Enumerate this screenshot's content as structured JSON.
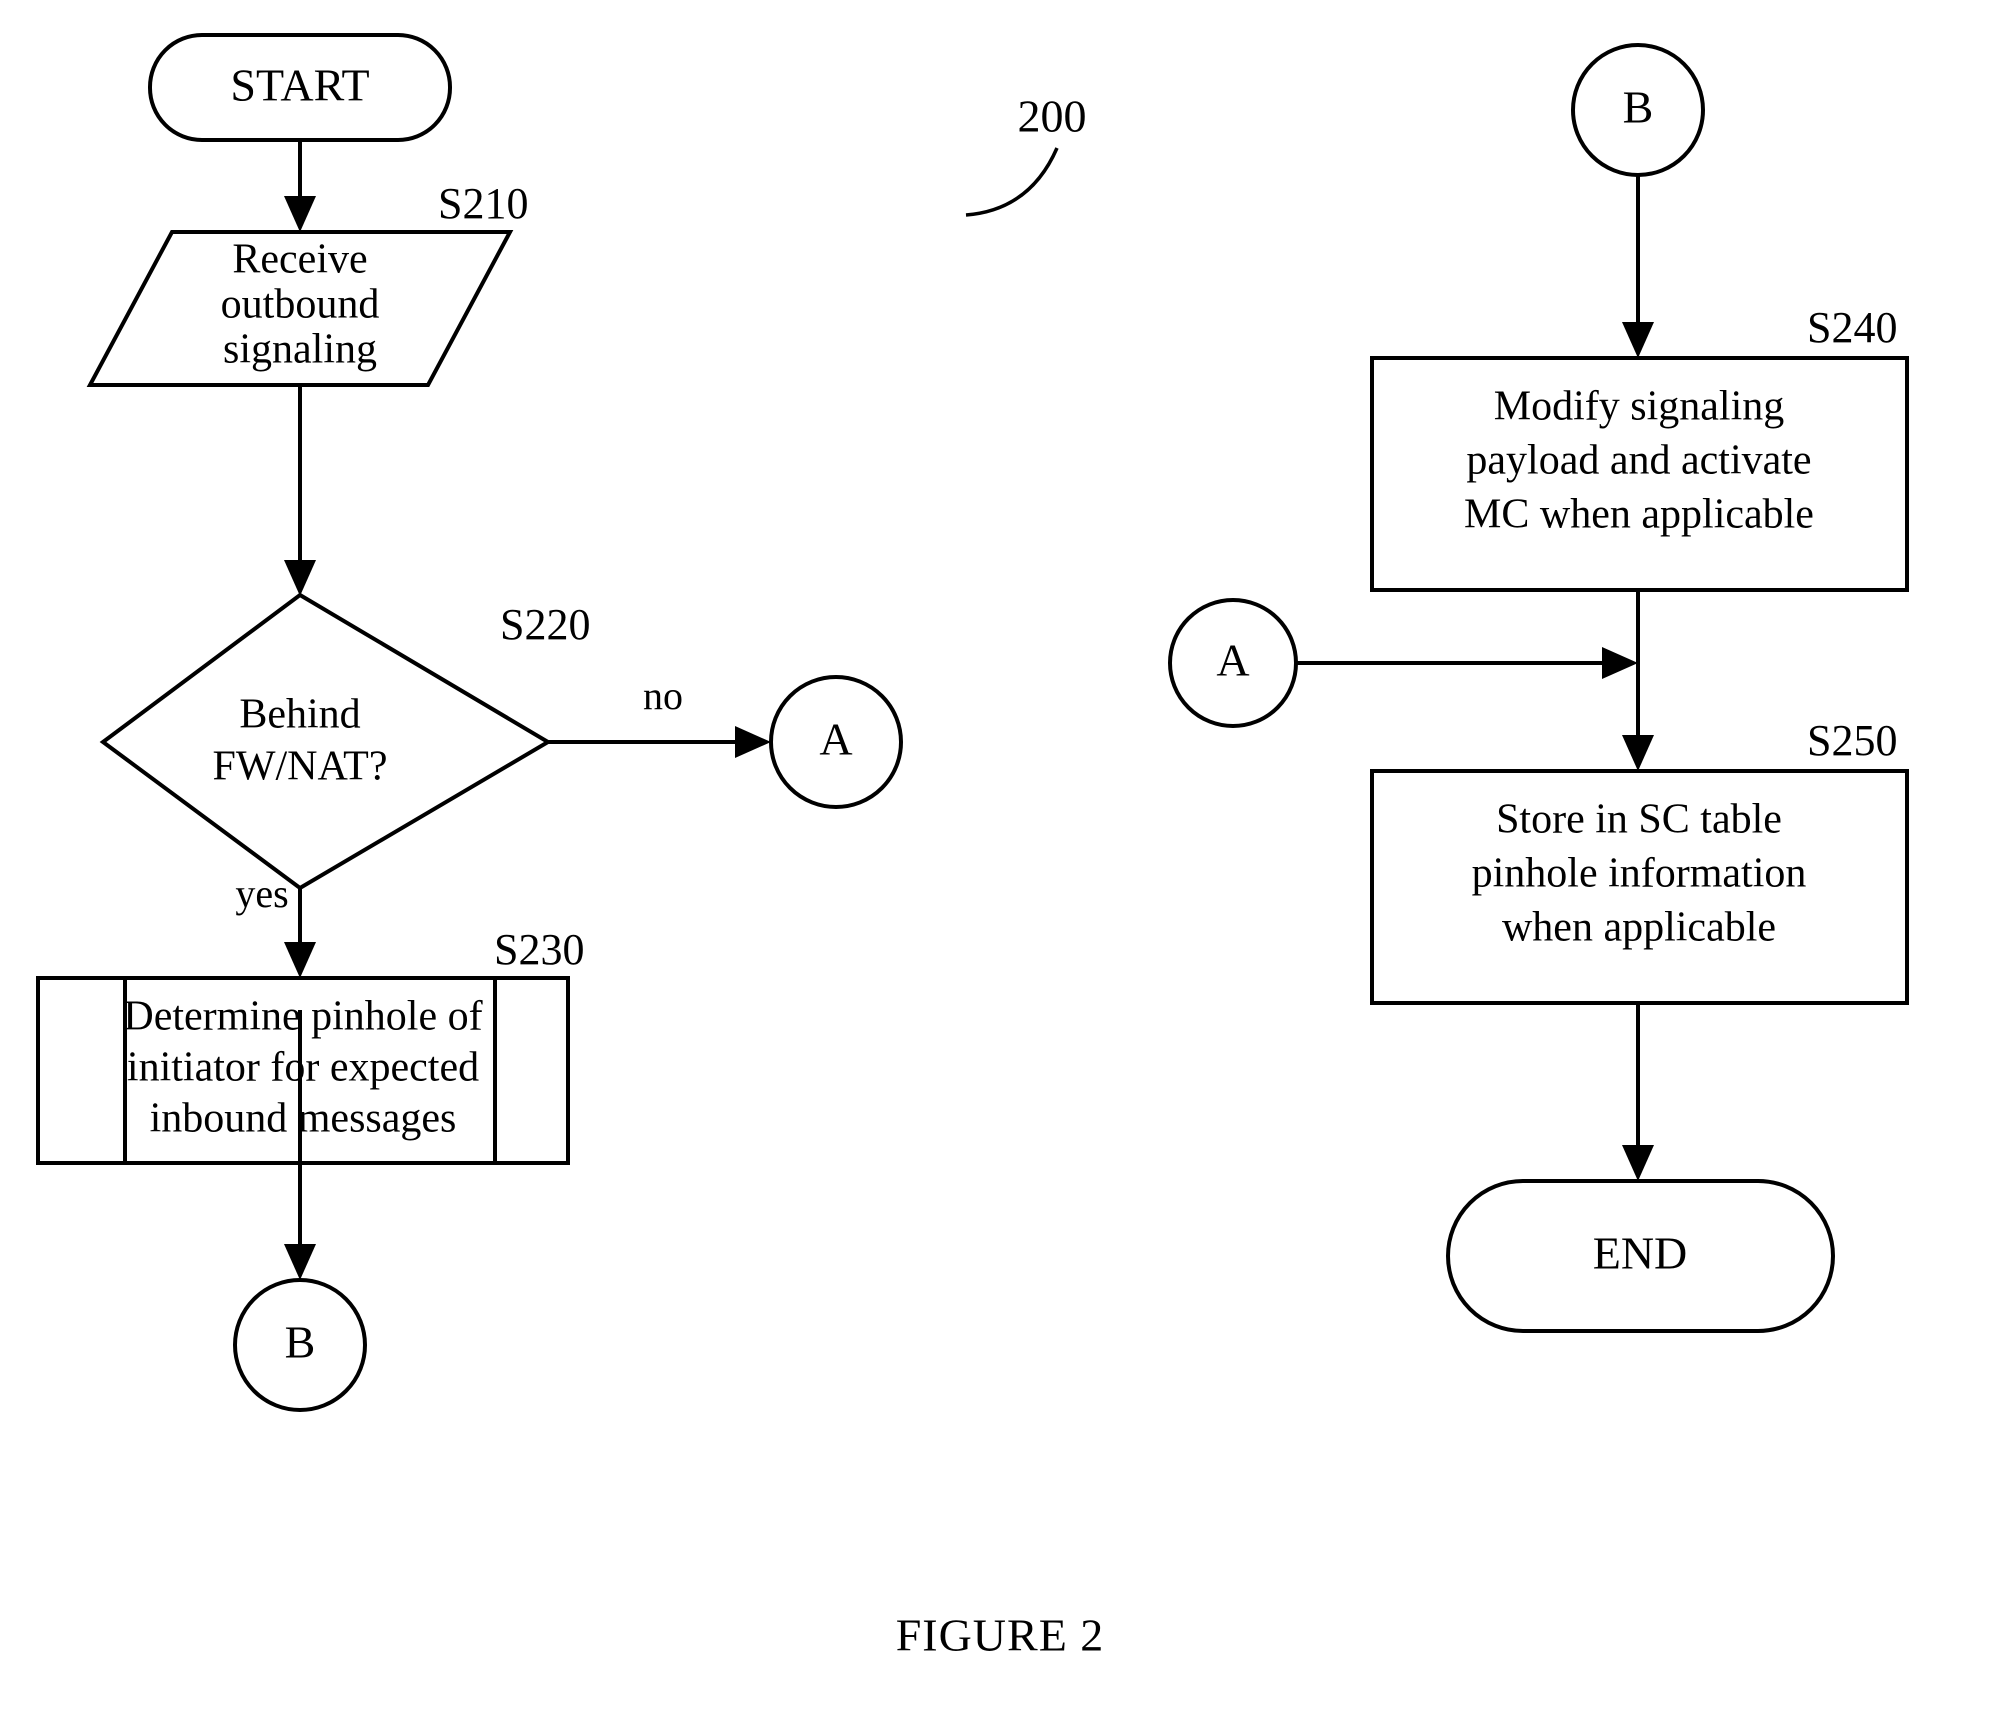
{
  "figure": {
    "caption": "FIGURE 2",
    "reference_numeral": "200"
  },
  "nodes": {
    "start": {
      "label": "START",
      "shape": "terminator"
    },
    "s210": {
      "step": "S210",
      "shape": "data-parallelogram",
      "lines": [
        "Receive",
        "outbound",
        "signaling"
      ]
    },
    "s220": {
      "step": "S220",
      "shape": "decision",
      "lines": [
        "Behind",
        "FW/NAT?"
      ]
    },
    "s230": {
      "step": "S230",
      "shape": "predefined-process",
      "lines": [
        "Determine pinhole of",
        "initiator for expected",
        "inbound messages"
      ]
    },
    "s240": {
      "step": "S240",
      "shape": "process",
      "lines": [
        "Modify signaling",
        "payload and activate",
        "MC when applicable"
      ]
    },
    "s250": {
      "step": "S250",
      "shape": "process",
      "lines": [
        "Store in SC table",
        "pinhole information",
        "when applicable"
      ]
    },
    "end": {
      "label": "END",
      "shape": "terminator"
    },
    "connector_a_out": {
      "label": "A",
      "shape": "connector"
    },
    "connector_a_in": {
      "label": "A",
      "shape": "connector"
    },
    "connector_b_out": {
      "label": "B",
      "shape": "connector"
    },
    "connector_b_in": {
      "label": "B",
      "shape": "connector"
    }
  },
  "edge_labels": {
    "decision_no": "no",
    "decision_yes": "yes"
  }
}
